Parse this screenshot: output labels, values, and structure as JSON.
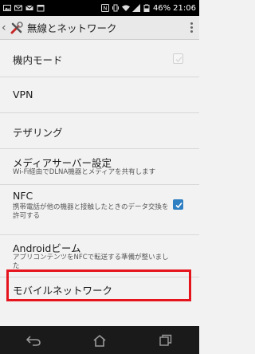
{
  "status_bar": {
    "time": "21:06",
    "battery": "46%",
    "icons_left": [
      "image-icon",
      "mail-icon",
      "email-icon",
      "calendar-icon"
    ],
    "icons_right": [
      "nfc-icon",
      "vibrate-icon",
      "wifi-icon",
      "signal-icon",
      "battery-icon"
    ]
  },
  "action_bar": {
    "title": "無線とネットワーク",
    "back_icon": "chevron-left-icon",
    "app_icon": "settings-tools-icon",
    "menu_icon": "overflow-menu-icon"
  },
  "settings": [
    {
      "id": "airplane",
      "title": "機内モード",
      "checkbox": "disabled"
    },
    {
      "id": "vpn",
      "title": "VPN"
    },
    {
      "id": "tethering",
      "title": "テザリング"
    },
    {
      "id": "media-server",
      "title": "メディアサーバー設定",
      "summary": "Wi-Fi経由でDLNA機器とメディアを共有します"
    },
    {
      "id": "nfc",
      "title": "NFC",
      "summary": "携帯電話が他の機器と接触したときのデータ交換を許可する",
      "checkbox": "checked"
    },
    {
      "id": "android-beam",
      "title": "Androidビーム",
      "summary": "アプリコンテンツをNFCで転送する準備が整いました"
    },
    {
      "id": "mobile-network",
      "title": "モバイルネットワーク",
      "highlighted": true
    }
  ],
  "colors": {
    "highlight": "#e5141d",
    "checkbox_on": "#2f7fc3",
    "background": "#f2f2f2"
  },
  "nav_bar": {
    "buttons": [
      "back-icon",
      "home-icon",
      "recent-apps-icon"
    ]
  }
}
